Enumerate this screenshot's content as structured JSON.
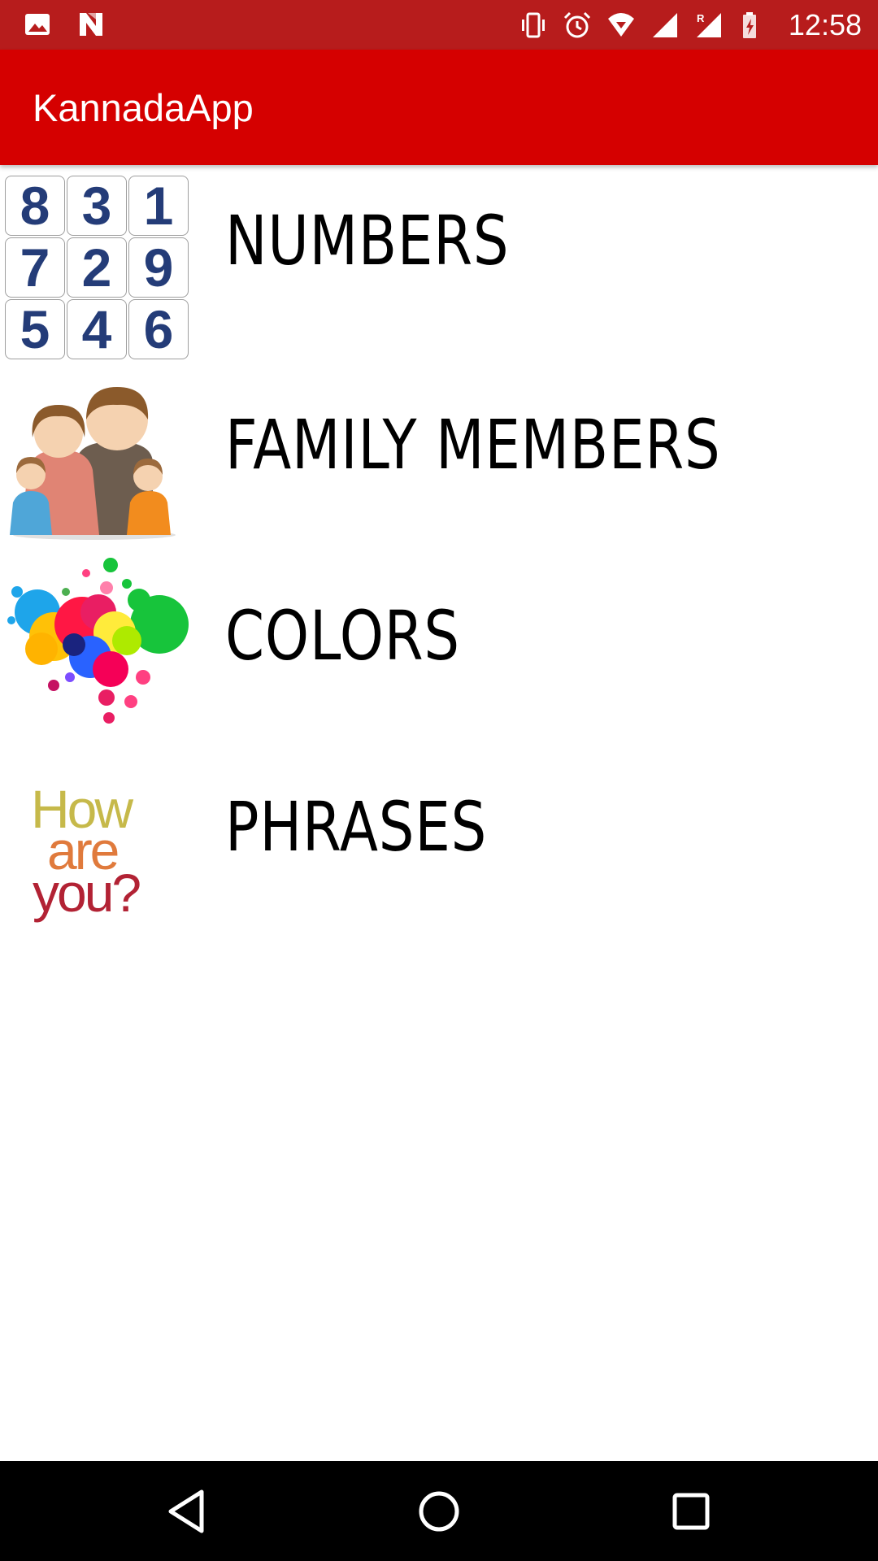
{
  "status_bar": {
    "time": "12:58",
    "icons_left": [
      "image-icon",
      "n-notification-icon"
    ],
    "icons_right": [
      "vibrate-icon",
      "alarm-icon",
      "wifi-icon",
      "signal-icon",
      "roaming-signal-icon",
      "battery-charging-icon"
    ],
    "background": "#b71c1c"
  },
  "app_bar": {
    "title": "KannadaApp",
    "background": "#d50000"
  },
  "categories": [
    {
      "label": "NUMBERS",
      "icon": "number-grid-icon",
      "digits": [
        "8",
        "3",
        "1",
        "7",
        "2",
        "9",
        "5",
        "4",
        "6"
      ]
    },
    {
      "label": "FAMILY MEMBERS",
      "icon": "family-icon"
    },
    {
      "label": "COLORS",
      "icon": "paint-splash-icon"
    },
    {
      "label": "PHRASES",
      "icon": "how-are-you-icon",
      "icon_text": [
        "How",
        "are",
        "you?"
      ]
    }
  ],
  "nav_bar": {
    "buttons": [
      "back",
      "home",
      "recents"
    ]
  }
}
